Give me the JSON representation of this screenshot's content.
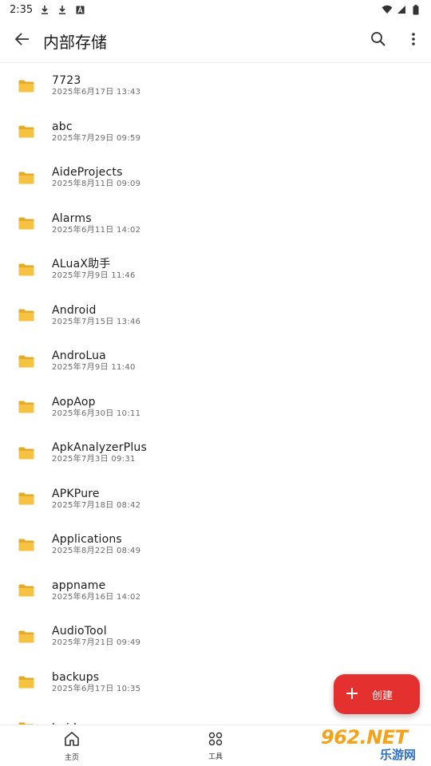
{
  "status_bar": {
    "time": "2:35",
    "icons": [
      "download-icon",
      "download-icon",
      "notification-a-icon"
    ],
    "right_icons": [
      "wifi-icon",
      "signal-icon",
      "battery-icon"
    ]
  },
  "app_bar": {
    "title": "内部存储",
    "back_icon": "back-arrow-icon",
    "search_icon": "search-icon",
    "more_icon": "more-vert-icon"
  },
  "files": [
    {
      "name": "7723",
      "date": "2025年6月17日 13:43"
    },
    {
      "name": "abc",
      "date": "2025年7月29日 09:59"
    },
    {
      "name": "AideProjects",
      "date": "2025年8月11日 09:09"
    },
    {
      "name": "Alarms",
      "date": "2025年6月11日 14:02"
    },
    {
      "name": "ALuaX助手",
      "date": "2025年7月9日 11:46"
    },
    {
      "name": "Android",
      "date": "2025年7月15日 13:46"
    },
    {
      "name": "AndroLua",
      "date": "2025年7月9日 11:40"
    },
    {
      "name": "AopAop",
      "date": "2025年6月30日 10:11"
    },
    {
      "name": "ApkAnalyzerPlus",
      "date": "2025年7月3日 09:31"
    },
    {
      "name": "APKPure",
      "date": "2025年7月18日 08:42"
    },
    {
      "name": "Applications",
      "date": "2025年8月22日 08:49"
    },
    {
      "name": "appname",
      "date": "2025年6月16日 14:02"
    },
    {
      "name": "AudioTool",
      "date": "2025年7月21日 09:49"
    },
    {
      "name": "backups",
      "date": "2025年6月17日 10:35"
    },
    {
      "name": "baidu",
      "date": ""
    }
  ],
  "fab": {
    "label": "创建",
    "color": "#e53030"
  },
  "bottom_nav": {
    "items": [
      {
        "label": "主页",
        "icon": "home-icon"
      },
      {
        "label": "工具",
        "icon": "tools-grid-icon"
      }
    ]
  },
  "watermark": {
    "main": "962.NET",
    "sub": "乐游网"
  },
  "colors": {
    "folder": "#f5c242",
    "folder_dark": "#e3ab28",
    "accent": "#e53030"
  }
}
